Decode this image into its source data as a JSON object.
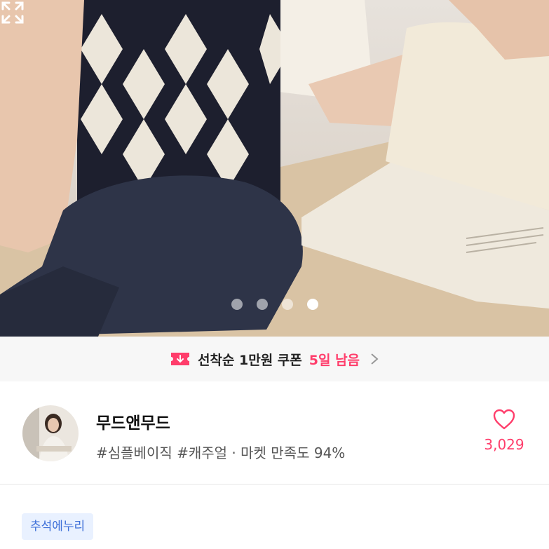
{
  "carousel": {
    "slide_count": 4,
    "active_index": 3
  },
  "coupon": {
    "icon": "coupon-download-icon",
    "text": "선착순 1만원 쿠폰",
    "remaining": "5일 남음",
    "accent": "#ff3d6b"
  },
  "shop": {
    "name": "무드앤무드",
    "meta": "#심플베이직 #캐주얼 · 마켓 만족도 94%",
    "like_count": "3,029"
  },
  "tags": [
    {
      "label": "추석에누리"
    }
  ]
}
